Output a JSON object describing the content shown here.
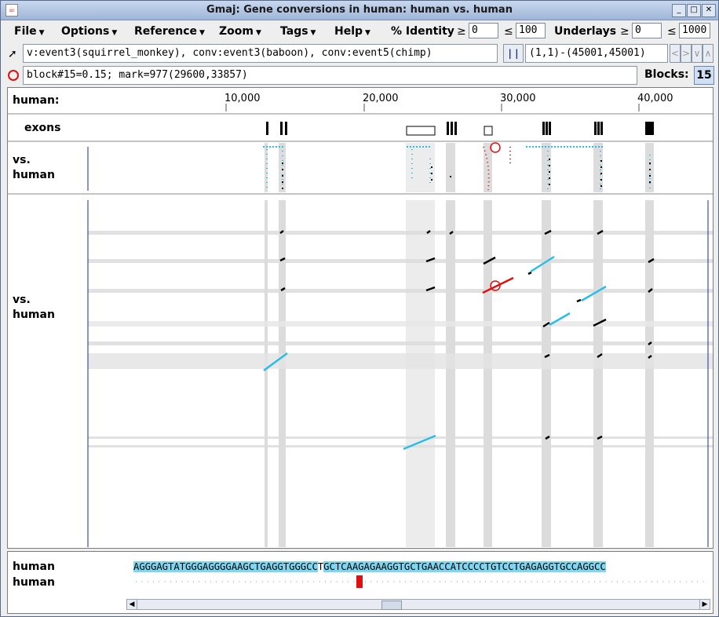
{
  "window": {
    "title": "Gmaj: Gene conversions in human: human vs. human",
    "buttons": [
      "_",
      "□",
      "✕"
    ]
  },
  "menus": [
    {
      "label": "File"
    },
    {
      "label": "Options"
    },
    {
      "label": "Reference"
    },
    {
      "label": "Zoom"
    },
    {
      "label": "Tags"
    },
    {
      "label": "Help"
    }
  ],
  "filters": {
    "identity_label": "% Identity",
    "geq": "≥",
    "leq": "≤",
    "identity_min": "0",
    "identity_max": "100",
    "underlays_label": "Underlays",
    "underlays_min": "0",
    "underlays_max": "1000"
  },
  "toolbar": {
    "selection_text": "v:event3(squirrel_monkey), conv:event3(baboon), conv:event5(chimp)",
    "bar_symbol": "| |",
    "range_text": "(1,1)-(45001,45001)",
    "nav": [
      "<",
      ">",
      "∨",
      "∧"
    ]
  },
  "status": {
    "info_text": "block#15=0.15; mark=977(29600,33857)",
    "blocks_label": "Blocks:",
    "blocks_value": "15"
  },
  "ruler": {
    "label": "human:",
    "ticks": [
      "10,000",
      "20,000",
      "30,000",
      "40,000"
    ]
  },
  "tracks": {
    "exons_label": "exons",
    "small_plot_label_1": "vs.",
    "small_plot_label_2": "human",
    "big_plot_label_1": "vs.",
    "big_plot_label_2": "human"
  },
  "sequence": {
    "row1_label": "human",
    "row2_label": "human",
    "seq_left": "AGGGAGTATGGGAGGGGAAGCTGAGGTGGGCC",
    "seq_mark": "T",
    "seq_right": "GCTCAAGAGAAGGTGCTGAACCATCCCCTGTCCTGAGAGGTGCCAGGCC"
  },
  "colors": {
    "accent_cyan": "#29bde8",
    "mark_red": "#e01010",
    "axis_blue": "#1a2aa0"
  }
}
